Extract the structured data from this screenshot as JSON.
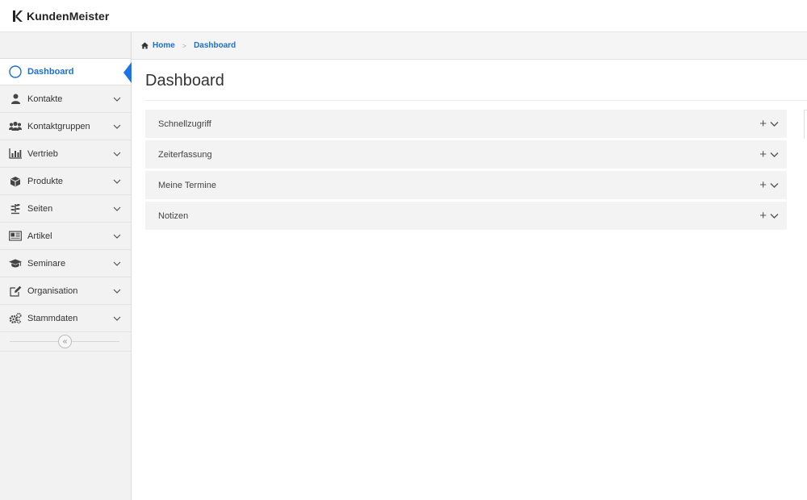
{
  "app": {
    "name": "KundenMeister"
  },
  "breadcrumb": {
    "home": "Home",
    "current": "Dashboard"
  },
  "page": {
    "title": "Dashboard"
  },
  "sidebar": {
    "items": [
      {
        "label": "Dashboard",
        "icon": "circle-icon",
        "active": true
      },
      {
        "label": "Kontakte",
        "icon": "user-icon"
      },
      {
        "label": "Kontaktgruppen",
        "icon": "users-icon"
      },
      {
        "label": "Vertrieb",
        "icon": "bar-chart-icon"
      },
      {
        "label": "Produkte",
        "icon": "cube-icon"
      },
      {
        "label": "Seiten",
        "icon": "plant-icon"
      },
      {
        "label": "Artikel",
        "icon": "newspaper-icon"
      },
      {
        "label": "Seminare",
        "icon": "graduation-cap-icon"
      },
      {
        "label": "Organisation",
        "icon": "edit-icon"
      },
      {
        "label": "Stammdaten",
        "icon": "gears-icon"
      }
    ],
    "collapse_glyph": "«"
  },
  "panels": [
    {
      "label": "Schnellzugriff"
    },
    {
      "label": "Zeiterfassung"
    },
    {
      "label": "Meine Termine"
    },
    {
      "label": "Notizen"
    }
  ],
  "colors": {
    "accent": "#1a73e8",
    "link": "#1a6fcf",
    "sidebar_bg": "#f2f2f2",
    "panel_bg": "#f3f3f3"
  }
}
